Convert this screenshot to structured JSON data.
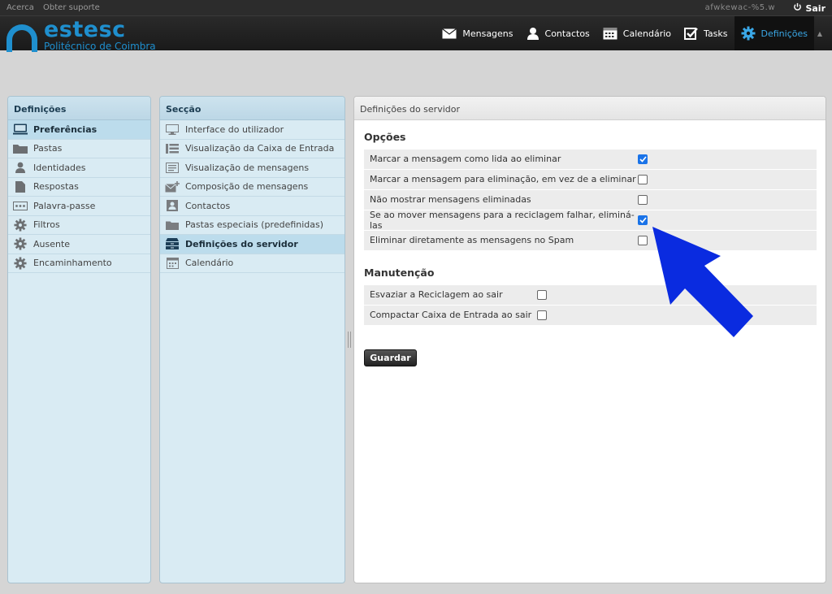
{
  "topbar": {
    "links": [
      "Acerca",
      "Obter suporte"
    ],
    "user": "afwkewac-%5.w",
    "logout": "Sair"
  },
  "brand": {
    "name": "estesc",
    "subtitle": "Politécnico de Coimbra"
  },
  "nav": [
    {
      "label": "Mensagens",
      "icon": "mail-icon"
    },
    {
      "label": "Contactos",
      "icon": "person-icon"
    },
    {
      "label": "Calendário",
      "icon": "calendar-icon"
    },
    {
      "label": "Tasks",
      "icon": "checkbox-icon"
    },
    {
      "label": "Definições",
      "icon": "gear-icon",
      "active": true
    }
  ],
  "settings_panel": {
    "title": "Definições",
    "items": [
      {
        "label": "Preferências",
        "icon": "monitor-icon",
        "selected": true
      },
      {
        "label": "Pastas",
        "icon": "folder-icon"
      },
      {
        "label": "Identidades",
        "icon": "person-icon"
      },
      {
        "label": "Respostas",
        "icon": "document-icon"
      },
      {
        "label": "Palavra-passe",
        "icon": "password-icon"
      },
      {
        "label": "Filtros",
        "icon": "gear-icon"
      },
      {
        "label": "Ausente",
        "icon": "gear-icon"
      },
      {
        "label": "Encaminhamento",
        "icon": "gear-icon"
      }
    ]
  },
  "section_panel": {
    "title": "Secção",
    "items": [
      {
        "label": "Interface do utilizador",
        "icon": "monitor-icon"
      },
      {
        "label": "Visualização da Caixa de Entrada",
        "icon": "list-icon"
      },
      {
        "label": "Visualização de mensagens",
        "icon": "message-view-icon"
      },
      {
        "label": "Composição de mensagens",
        "icon": "compose-icon"
      },
      {
        "label": "Contactos",
        "icon": "contact-card-icon"
      },
      {
        "label": "Pastas especiais (predefinidas)",
        "icon": "folder-icon"
      },
      {
        "label": "Definições do servidor",
        "icon": "server-icon",
        "selected": true
      },
      {
        "label": "Calendário",
        "icon": "calendar-icon"
      }
    ]
  },
  "server_panel": {
    "title": "Definições do servidor",
    "options_title": "Opções",
    "options": [
      {
        "label": "Marcar a mensagem como lida ao eliminar",
        "checked": true
      },
      {
        "label": "Marcar a mensagem para eliminação, em vez de a eliminar",
        "checked": false
      },
      {
        "label": "Não mostrar mensagens eliminadas",
        "checked": false
      },
      {
        "label": "Se ao mover mensagens para a reciclagem falhar, eliminá-las",
        "checked": true
      },
      {
        "label": "Eliminar diretamente as mensagens no Spam",
        "checked": false
      }
    ],
    "maintenance_title": "Manutenção",
    "maintenance": [
      {
        "label": "Esvaziar a Reciclagem ao sair",
        "checked": false
      },
      {
        "label": "Compactar Caixa de Entrada ao sair",
        "checked": false
      }
    ],
    "save_label": "Guardar"
  },
  "colors": {
    "accent": "#1f8fce",
    "annotation_arrow": "#0a2be0",
    "checkbox_on": "#1a73e8"
  }
}
